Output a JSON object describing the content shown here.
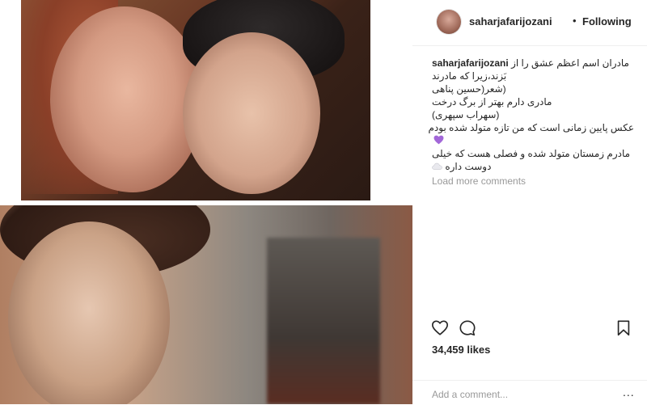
{
  "post": {
    "username": "saharjafarijozani",
    "follow_separator": "•",
    "follow_status": "Following",
    "caption": {
      "first_line": "مادران اسم اعظم عشق را از",
      "lines": [
        "بَزند،زیرا که مادرند",
        "(شعر(حسین پناهی",
        "مادری دارم بهتر از برگ درخت",
        "(سهراب سپهری)",
        "عکس پایین زمانی است که من تازه متولد شده بودم",
        "مادرم زمستان متولد شده و فصلی هست که خیلی",
        "دوست داره"
      ],
      "emojis": [
        "purple-heart-icon",
        "cloud-icon"
      ]
    },
    "load_more_label": "Load more comments",
    "likes_count": "34,459",
    "likes_label": "likes",
    "comment_placeholder": "Add a comment...",
    "more_options_label": "..."
  },
  "icons": {
    "like": "heart-outline-icon",
    "comment": "speech-bubble-icon",
    "save": "bookmark-icon",
    "avatar": "profile-avatar"
  },
  "colors": {
    "text": "#262626",
    "muted": "#999999",
    "emoji_heart": "#a267d8",
    "divider": "#efefef"
  }
}
